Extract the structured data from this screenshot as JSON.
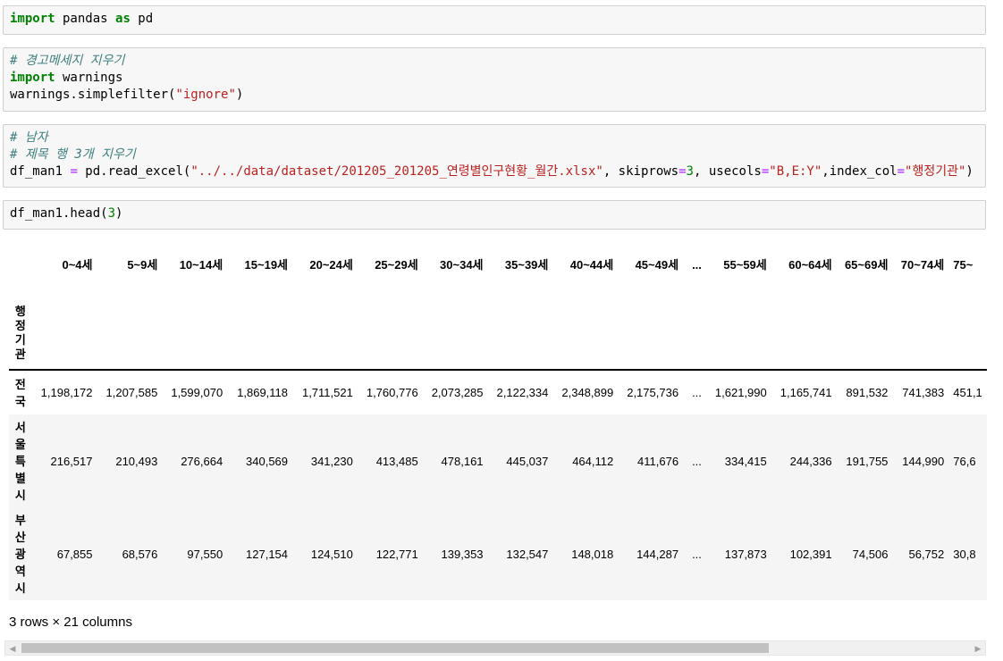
{
  "cells": [
    {
      "line1": {
        "kw": "import",
        "mid": " pandas ",
        "kw2": "as",
        "tail": " pd"
      }
    },
    {
      "comment": "# 경고메세지 지우기",
      "line2kw": "import",
      "line2rest": " warnings",
      "line3a": "warnings.simplefilter(",
      "line3str": "\"ignore\"",
      "line3b": ")"
    },
    {
      "comment1": "# 남자",
      "comment2": "# 제목 행 3개 지우기",
      "var": "df_man1 ",
      "eq": "=",
      "call": " pd.read_excel(",
      "path": "\"../../data/dataset/201205_201205_연령별인구현황_월간.xlsx\"",
      "a1": ", skiprows",
      "eq2": "=",
      "n3": "3",
      "a2": ", usecols",
      "eq3": "=",
      "cols": "\"B,E:Y\"",
      "a3": ",index_col",
      "eq4": "=",
      "idx": "\"행정기관\"",
      "close": ")"
    },
    {
      "pre": "df_man1.head(",
      "num": "3",
      "post": ")"
    }
  ],
  "dataframe": {
    "index_name": "행정기관",
    "columns": [
      "0~4세",
      "5~9세",
      "10~14세",
      "15~19세",
      "20~24세",
      "25~29세",
      "30~34세",
      "35~39세",
      "40~44세",
      "45~49세",
      "...",
      "55~59세",
      "60~64세",
      "65~69세",
      "70~74세",
      "75~"
    ],
    "rows": [
      {
        "label": "전국",
        "values": [
          "1,198,172",
          "1,207,585",
          "1,599,070",
          "1,869,118",
          "1,711,521",
          "1,760,776",
          "2,073,285",
          "2,122,334",
          "2,348,899",
          "2,175,736",
          "...",
          "1,621,990",
          "1,165,741",
          "891,532",
          "741,383",
          "451,1"
        ]
      },
      {
        "label": "서울특별시",
        "values": [
          "216,517",
          "210,493",
          "276,664",
          "340,569",
          "341,230",
          "413,485",
          "478,161",
          "445,037",
          "464,112",
          "411,676",
          "...",
          "334,415",
          "244,336",
          "191,755",
          "144,990",
          "76,6"
        ]
      },
      {
        "label": "부산광역시",
        "values": [
          "67,855",
          "68,576",
          "97,550",
          "127,154",
          "124,510",
          "122,771",
          "139,353",
          "132,547",
          "148,018",
          "144,287",
          "...",
          "137,873",
          "102,391",
          "74,506",
          "56,752",
          "30,8"
        ]
      }
    ],
    "shape_text": "3 rows × 21 columns"
  }
}
